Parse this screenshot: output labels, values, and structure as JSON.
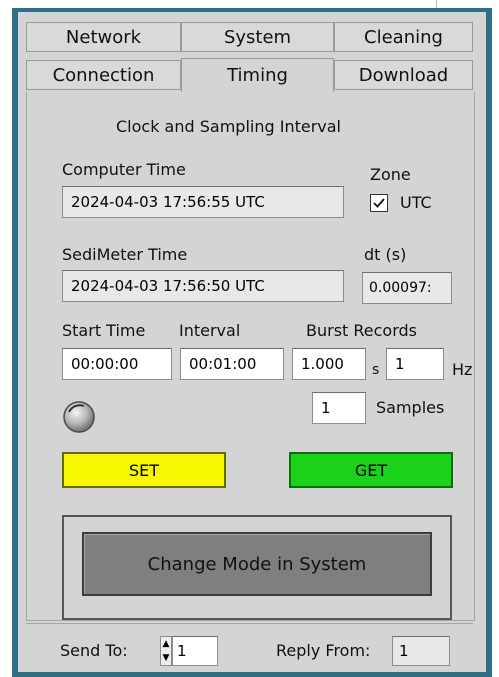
{
  "tabs": {
    "row1": [
      "Network",
      "System",
      "Cleaning"
    ],
    "row2": [
      "Connection",
      "Timing",
      "Download"
    ]
  },
  "section_title": "Clock and Sampling Interval",
  "computer_time": {
    "label": "Computer Time",
    "value": "2024-04-03 17:56:55 UTC"
  },
  "zone": {
    "label": "Zone",
    "checkbox_label": "UTC",
    "checked": true
  },
  "sedimeter_time": {
    "label": "SediMeter Time",
    "value": "2024-04-03 17:56:50 UTC"
  },
  "dt": {
    "label": "dt (s)",
    "value": "0.00097:"
  },
  "start_time": {
    "label": "Start Time",
    "value": "00:00:00"
  },
  "interval": {
    "label": "Interval",
    "value": "00:01:00"
  },
  "burst": {
    "label": "Burst Records",
    "seconds_value": "1.000",
    "seconds_unit": "s",
    "hz_value": "1",
    "hz_unit": "Hz",
    "samples_value": "1",
    "samples_label": "Samples"
  },
  "buttons": {
    "set": "SET",
    "get": "GET",
    "change_mode": "Change Mode in System"
  },
  "footer": {
    "send_to_label": "Send To:",
    "send_to_value": "1",
    "reply_from_label": "Reply From:",
    "reply_from_value": "1"
  },
  "colors": {
    "set": "#f7f700",
    "get": "#19d219",
    "frame": "#2f6f86"
  }
}
